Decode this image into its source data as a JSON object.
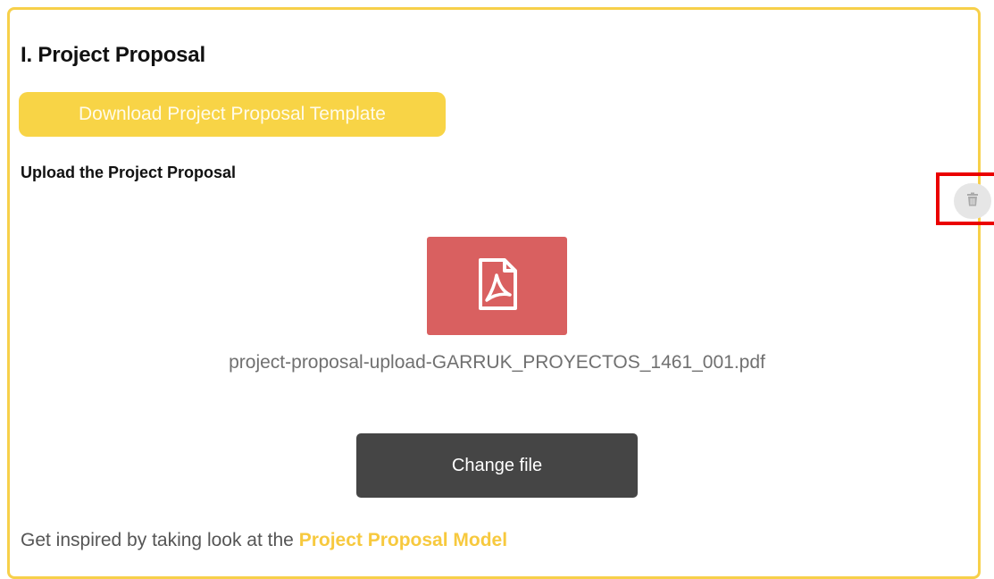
{
  "section": {
    "title": "I. Project Proposal",
    "download_button": "Download Project Proposal Template",
    "upload_label": "Upload the Project Proposal"
  },
  "file": {
    "icon": "pdf-file-icon",
    "name": "project-proposal-upload-GARRUK_PROYECTOS_1461_001.pdf",
    "delete_icon": "trash-icon"
  },
  "actions": {
    "change_file": "Change file"
  },
  "footer": {
    "prefix": "Get inspired by taking look at the",
    "link": "Project Proposal Model"
  },
  "colors": {
    "accent_yellow": "#f8d446",
    "pdf_tile": "#d96060",
    "dark_button": "#454545",
    "highlight_red": "#ea0000"
  }
}
